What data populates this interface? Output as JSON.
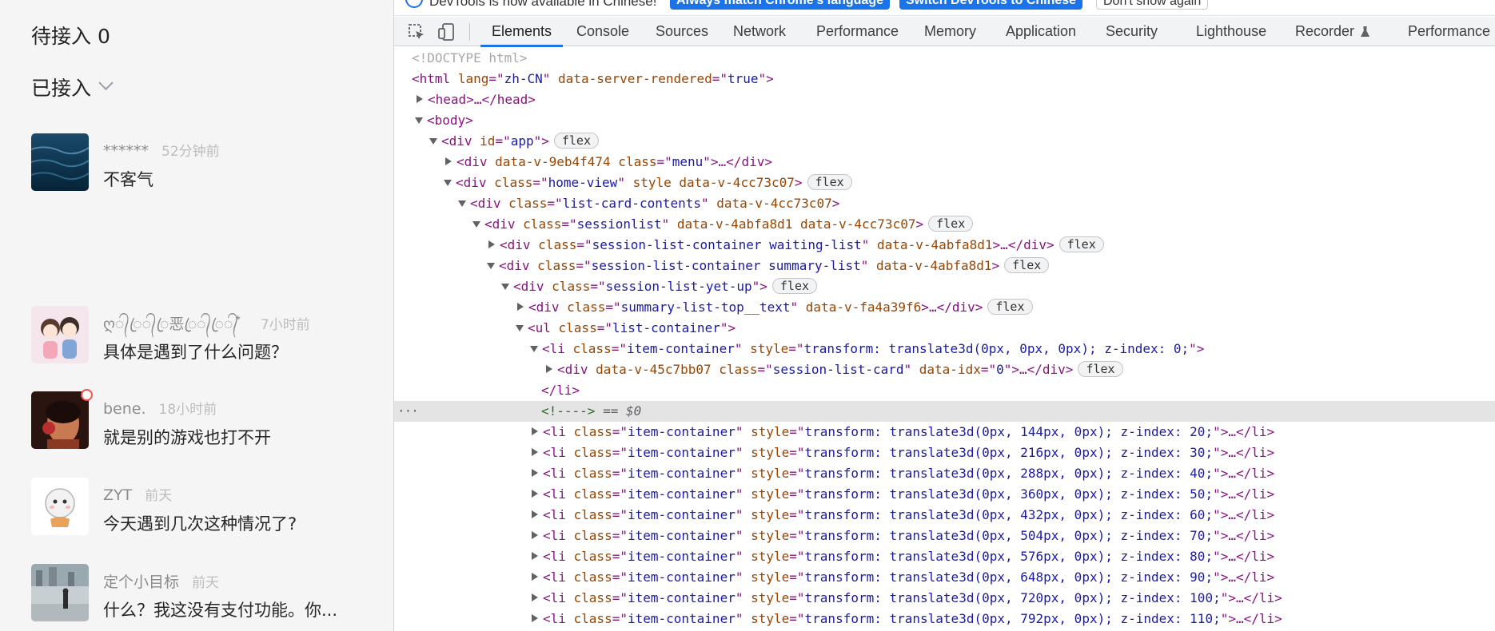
{
  "left_panel": {
    "waiting_title": "待接入 0",
    "accepted_title": "已接入",
    "chats": [
      {
        "name": "******",
        "time": "52分钟前",
        "message": "不客气",
        "avatar": "ocean-avatar",
        "unread": false
      },
      {
        "name": "ღ᭄ꦿ᭄ꦿ恶ꦿ᭄ꦿ᭄ ໋ ",
        "time": "7小时前",
        "message": "具体是遇到了什么问题？",
        "avatar": "couple-avatar",
        "unread": false
      },
      {
        "name": "bene.",
        "time": "18小时前",
        "message": "就是别的游戏也打不开",
        "avatar": "portrait-avatar",
        "unread": true
      },
      {
        "name": "ZYT",
        "time": "前天",
        "message": "今天遇到几次这种情况了?",
        "avatar": "cartoon-avatar",
        "unread": false
      },
      {
        "name": "定个小目标",
        "time": "前天",
        "message": "什么？我这没有支付功能。你...",
        "avatar": "street-avatar",
        "unread": false
      }
    ]
  },
  "devtools": {
    "language_bar": {
      "text": "DevTools is now available in Chinese!",
      "buttons": [
        "Always match Chrome's language",
        "Switch DevTools to Chinese",
        "Don't show again"
      ]
    },
    "tabs": [
      "Elements",
      "Console",
      "Sources",
      "Network",
      "Performance",
      "Memory",
      "Application",
      "Security",
      "Lighthouse",
      "Recorder",
      "Performance in"
    ],
    "active_tab": "Elements",
    "dom": {
      "doctype": "<!DOCTYPE html>",
      "html_tag": "html",
      "html_lang_attr": "lang",
      "html_lang_val": "zh-CN",
      "html_ssr_attr": "data-server-rendered",
      "html_ssr_val": "true",
      "head_tag": "head",
      "body_tag": "body",
      "app_id": "app",
      "menu_attr": "data-v-9eb4f474",
      "menu_class": "menu",
      "home_class": "home-view",
      "home_extra": "style data-v-4cc73c07",
      "contents_class": "list-card-contents",
      "contents_attr": "data-v-4cc73c07",
      "sessionlist_class": "sessionlist",
      "sessionlist_attr": "data-v-4abfa8d1 data-v-4cc73c07",
      "waiting_class": "session-list-container waiting-list",
      "waiting_attr": "data-v-4abfa8d1",
      "summary_class": "session-list-container summary-list",
      "summary_attr": "data-v-4abfa8d1",
      "yetup_class": "session-list-yet-up",
      "toptext_class": "summary-list-top__text",
      "toptext_attr": "data-v-fa4a39f6",
      "ul_class": "list-container",
      "item_class": "item-container",
      "first_item_style": "transform: translate3d(0px, 0px, 0px); z-index: 0;",
      "card_attr": "data-v-45c7bb07",
      "card_class": "session-list-card",
      "card_idx_attr": "data-idx",
      "card_idx_val": "0",
      "comment": "<!---->",
      "selected_marker": "== $0",
      "badge_flex": "flex",
      "more_dots": "···",
      "item_styles": [
        "transform: translate3d(0px, 144px, 0px); z-index: 20;",
        "transform: translate3d(0px, 216px, 0px); z-index: 30;",
        "transform: translate3d(0px, 288px, 0px); z-index: 40;",
        "transform: translate3d(0px, 360px, 0px); z-index: 50;",
        "transform: translate3d(0px, 432px, 0px); z-index: 60;",
        "transform: translate3d(0px, 504px, 0px); z-index: 70;",
        "transform: translate3d(0px, 576px, 0px); z-index: 80;",
        "transform: translate3d(0px, 648px, 0px); z-index: 90;",
        "transform: translate3d(0px, 720px, 0px); z-index: 100;",
        "transform: translate3d(0px, 792px, 0px); z-index: 110;"
      ]
    }
  },
  "colors": {
    "accent": "#1a73e8",
    "tag": "#881280",
    "attr": "#994500",
    "value": "#1a1aa6",
    "unread": "#f2524b"
  }
}
